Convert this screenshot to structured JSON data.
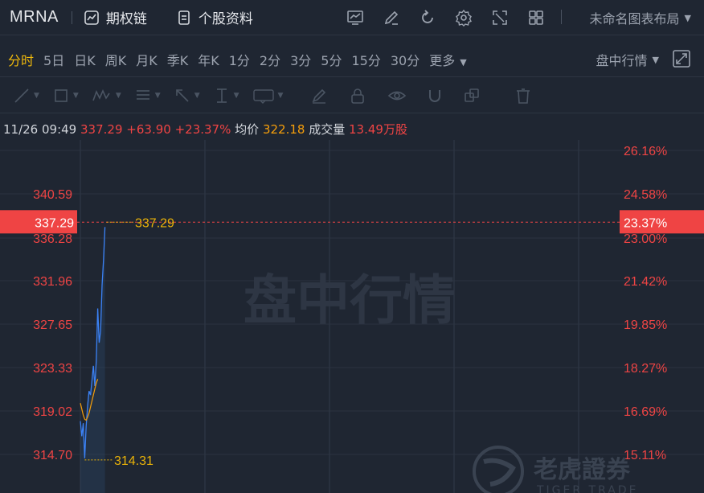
{
  "header": {
    "ticker": "MRNA",
    "options_chain": "期权链",
    "stock_profile": "个股资料",
    "layout_name": "未命名图表布局",
    "icons": [
      "chart-icon",
      "edit-icon",
      "refresh-icon",
      "settings-icon",
      "fullscreen-icon",
      "grid-icon"
    ]
  },
  "periods": {
    "items": [
      "分时",
      "5日",
      "日K",
      "周K",
      "月K",
      "季K",
      "年K",
      "1分",
      "2分",
      "3分",
      "5分",
      "15分",
      "30分",
      "更多"
    ],
    "active": "分时",
    "intraday_label": "盘中行情"
  },
  "info": {
    "datetime": "11/26 09:49",
    "price": "337.29",
    "change": "+63.90",
    "change_pct": "+23.37%",
    "avg_label": "均价",
    "avg_value": "322.18",
    "volume_label": "成交量",
    "volume_value": "13.49万股"
  },
  "chart_data": {
    "type": "line",
    "watermark": "盘中行情",
    "brand": "老虎證券",
    "brand_en": "TIGER TRADE",
    "y_left_ticks": [
      "340.59",
      "336.28",
      "331.96",
      "327.65",
      "323.33",
      "319.02",
      "314.70"
    ],
    "y_right_ticks": [
      "26.16%",
      "24.58%",
      "23.00%",
      "21.42%",
      "19.85%",
      "18.27%",
      "16.69%",
      "15.11%"
    ],
    "current_price": "337.29",
    "current_pct": "23.37%",
    "high_marker": "337.29",
    "low_marker": "314.31",
    "ylim": [
      312.55,
      342.74
    ],
    "x_minutes_shown": 19,
    "colors": {
      "price": "#3b82f6",
      "avg": "#f59e0b",
      "current": "#ef4444",
      "marker": "#eab308"
    },
    "price_series": [
      318.0,
      316.5,
      317.8,
      314.31,
      317.5,
      319.5,
      321.0,
      320.6,
      322.0,
      323.5,
      321.5,
      324.0,
      329.2,
      325.8,
      327.0,
      331.5,
      334.0,
      337.29
    ],
    "avg_series": [
      319.8,
      319.2,
      318.6,
      318.2,
      318.1,
      318.4,
      318.8,
      319.4,
      320.0,
      320.6,
      321.2,
      321.8,
      322.18
    ]
  },
  "colors": {
    "background": "#1f2632",
    "up": "#ef4444",
    "accent": "#f0b90b"
  }
}
